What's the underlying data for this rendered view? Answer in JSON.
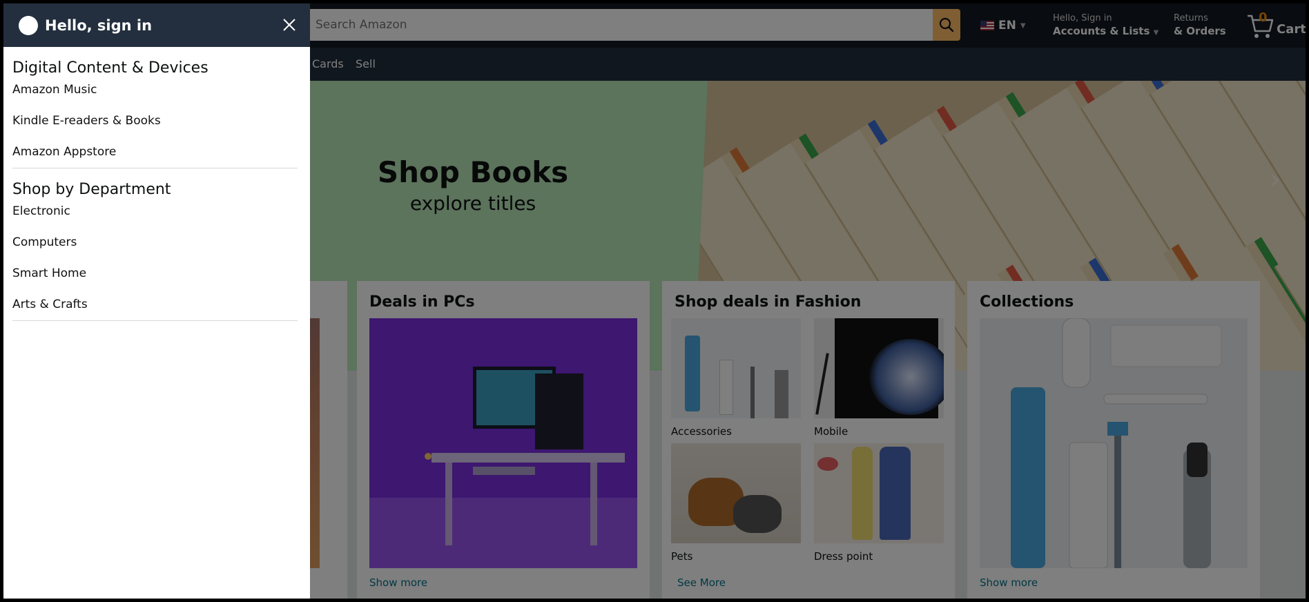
{
  "header": {
    "search_placeholder": "Search Amazon",
    "lang": "EN",
    "account_small": "Hello, Sign in",
    "account_big": "Accounts & Lists",
    "returns_small": "Returns",
    "returns_big": "& Orders",
    "cart_count": "0",
    "cart_label": "Cart"
  },
  "navbar": {
    "items": [
      "Cards",
      "Sell"
    ]
  },
  "hero": {
    "title": "Shop Books",
    "subtitle": "explore titles"
  },
  "cards": [
    {
      "title": "Deals in PCs",
      "link": "Show more"
    },
    {
      "title": "Shop deals in Fashion",
      "link": "See More",
      "tiles": [
        "Accessories",
        "Mobile",
        "Pets",
        "Dress point"
      ]
    },
    {
      "title": "Collections",
      "link": "Show more"
    }
  ],
  "panel": {
    "greeting": "Hello, sign in",
    "sections": [
      {
        "title": "Digital Content & Devices",
        "items": [
          "Amazon Music",
          "Kindle E-readers & Books",
          "Amazon Appstore"
        ]
      },
      {
        "title": "Shop by Department",
        "items": [
          "Electronic",
          "Computers",
          "Smart Home",
          "Arts & Crafts"
        ]
      }
    ]
  },
  "colors": {
    "header_bg": "#131921",
    "nav_bg": "#232f3e",
    "search_button": "#febd69",
    "cart_count": "#f08804",
    "link": "#007185",
    "hero_bg": "#b8e6b8"
  }
}
